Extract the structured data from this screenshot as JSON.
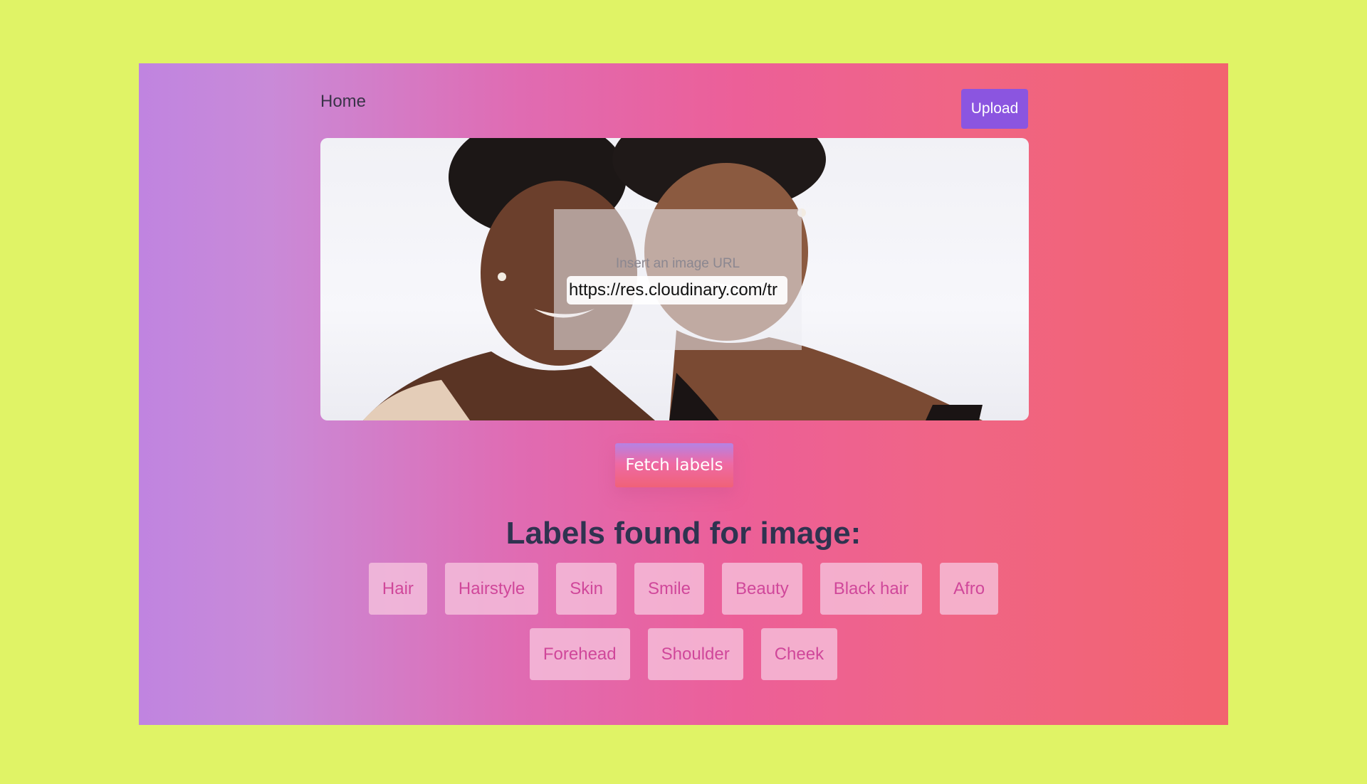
{
  "nav": {
    "home_label": "Home",
    "upload_label": "Upload"
  },
  "url_form": {
    "label": "Insert an image URL",
    "value": "https://res.cloudinary.com/tr"
  },
  "fetch_button_label": "Fetch labels",
  "results": {
    "heading": "Labels found for image:",
    "labels": [
      "Hair",
      "Hairstyle",
      "Skin",
      "Smile",
      "Beauty",
      "Black hair",
      "Afro",
      "Forehead",
      "Shoulder",
      "Cheek"
    ]
  },
  "colors": {
    "page_background": "#e0f366",
    "upload_button": "#8b55e0",
    "heading_text": "#2f3350",
    "chip_text": "#d0479a"
  }
}
